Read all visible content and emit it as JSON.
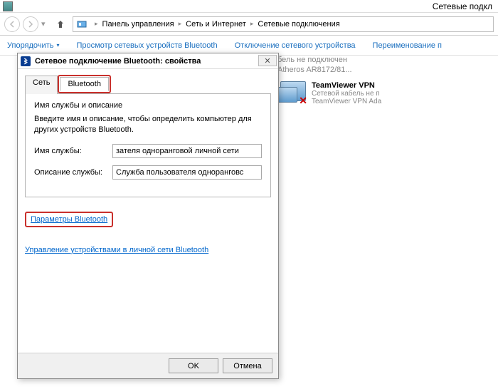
{
  "window_title": "Сетевые подкл",
  "breadcrumbs": {
    "seg1": "Панель управления",
    "seg2": "Сеть и Интернет",
    "seg3": "Сетевые подключения"
  },
  "toolbar": {
    "organize": "Упорядочить",
    "view_bt": "Просмотр сетевых устройств Bluetooth",
    "disable": "Отключение сетевого устройства",
    "rename": "Переименование п"
  },
  "adapter1": {
    "line1": "бель не подключен",
    "line2": "Atheros AR8172/81..."
  },
  "adapter2": {
    "name": "TeamViewer VPN",
    "status": "Сетевой кабель не п",
    "device": "TeamViewer VPN Ada"
  },
  "dialog": {
    "title": "Сетевое подключение Bluetooth: свойства",
    "tabs": {
      "net": "Сеть",
      "bt": "Bluetooth"
    },
    "group_label": "Имя службы и описание",
    "group_text": "Введите имя и описание, чтобы определить компьютер для других устройств Bluetooth.",
    "fld_name_label": "Имя службы:",
    "fld_name_value": "зателя одноранговой личной сети",
    "fld_desc_label": "Описание службы:",
    "fld_desc_value": "Служба пользователя одноранговс",
    "link_params": "Параметры Bluetooth",
    "link_manage": "Управление устройствами в личной сети Bluetooth",
    "ok": "OK",
    "cancel": "Отмена"
  }
}
